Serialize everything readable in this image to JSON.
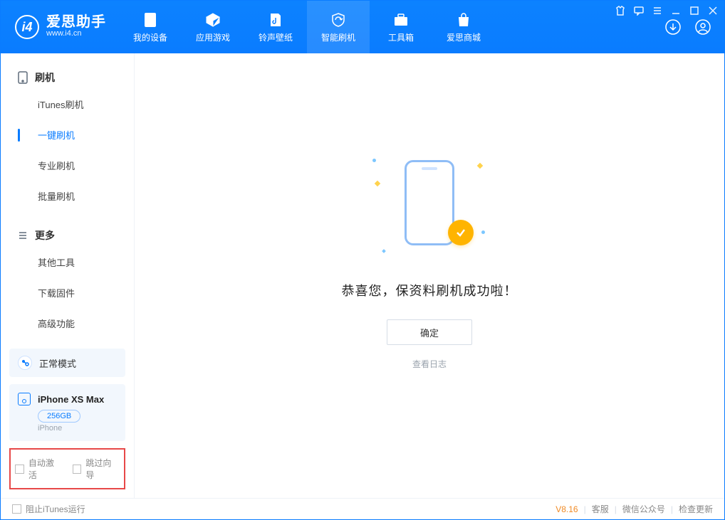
{
  "app": {
    "name_cn": "爱思助手",
    "url": "www.i4.cn"
  },
  "nav": [
    {
      "label": "我的设备"
    },
    {
      "label": "应用游戏"
    },
    {
      "label": "铃声壁纸"
    },
    {
      "label": "智能刷机"
    },
    {
      "label": "工具箱"
    },
    {
      "label": "爱思商城"
    }
  ],
  "sidebar": {
    "section1": {
      "title": "刷机",
      "items": [
        {
          "label": "iTunes刷机"
        },
        {
          "label": "一键刷机"
        },
        {
          "label": "专业刷机"
        },
        {
          "label": "批量刷机"
        }
      ]
    },
    "section2": {
      "title": "更多",
      "items": [
        {
          "label": "其他工具"
        },
        {
          "label": "下载固件"
        },
        {
          "label": "高级功能"
        }
      ]
    },
    "mode": "正常模式",
    "device": {
      "name": "iPhone XS Max",
      "storage": "256GB",
      "type": "iPhone"
    },
    "options": {
      "auto_activate": "自动激活",
      "skip_guide": "跳过向导"
    }
  },
  "main": {
    "success_text": "恭喜您，保资料刷机成功啦！",
    "ok_button": "确定",
    "view_log": "查看日志"
  },
  "footer": {
    "block_itunes": "阻止iTunes运行",
    "version": "V8.16",
    "links": {
      "support": "客服",
      "wechat": "微信公众号",
      "update": "检查更新"
    }
  }
}
